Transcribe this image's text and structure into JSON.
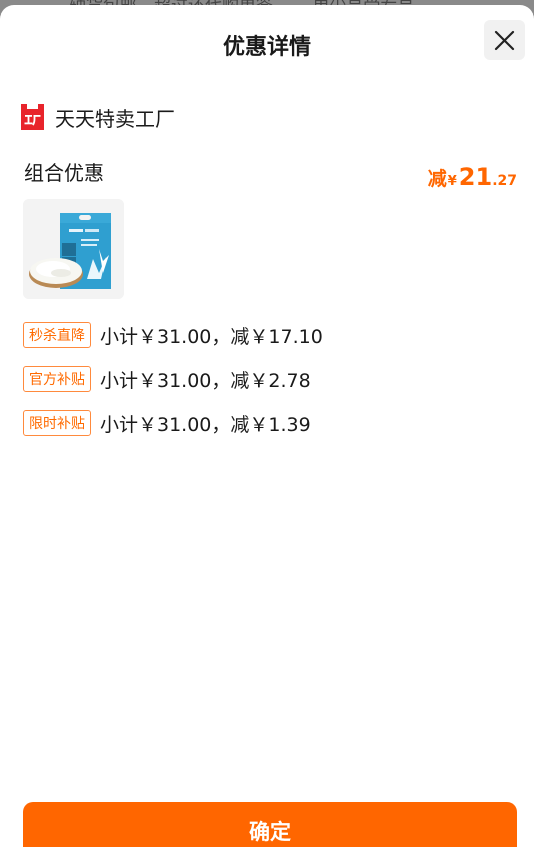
{
  "background_text": "…轴货包邮，超过还代购单签…  …更少享受专享…",
  "sheet": {
    "title": "优惠详情",
    "close_icon": "close-icon"
  },
  "shop": {
    "logo_icon": "factory-logo-icon",
    "name": "天天特卖工厂"
  },
  "combo": {
    "label": "组合优惠",
    "save_prefix": "减",
    "currency": "¥",
    "save_int": "21",
    "save_dec": ".27"
  },
  "product": {
    "image_name": "rice-bag-image"
  },
  "discounts": [
    {
      "tag": "秒杀直降",
      "text": "小计￥31.00，减￥17.10"
    },
    {
      "tag": "官方补贴",
      "text": "小计￥31.00，减￥2.78"
    },
    {
      "tag": "限时补贴",
      "text": "小计￥31.00，减￥1.39"
    }
  ],
  "confirm_label": "确定",
  "colors": {
    "accent": "#ff6600",
    "tag_border": "#ff8a3d",
    "logo_red": "#e8242b"
  }
}
